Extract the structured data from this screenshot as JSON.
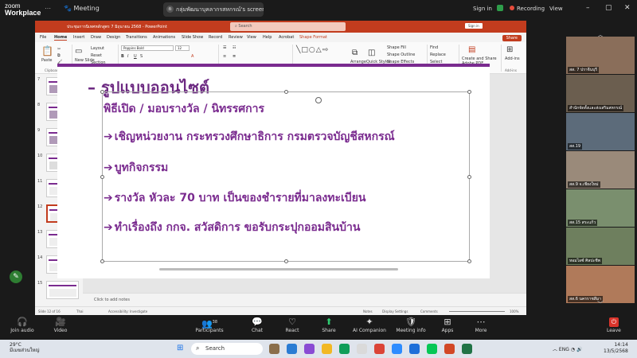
{
  "zoom": {
    "logo_line1": "zoom",
    "logo_line2": "Workplace",
    "meeting_label": "Meeting",
    "share_badge": "n",
    "share_label": "กลุ่มพัฒนาบุคลากรสหกรณ์'s screen",
    "sign_in": "Sign in",
    "recording": "Recording",
    "view": "View"
  },
  "ppt": {
    "window_title": "ประชุมการนิเทศหลักสูตร 7 มิถุนายน 2568 - PowerPoint",
    "search_placeholder": "Search",
    "sign_in": "Sign in",
    "share": "Share",
    "tabs": [
      "File",
      "Home",
      "Insert",
      "Draw",
      "Design",
      "Transitions",
      "Animations",
      "Slide Show",
      "Record",
      "Review",
      "View",
      "Help",
      "Acrobat",
      "Shape Format"
    ],
    "ribbon": {
      "paste": "Paste",
      "new_slide": "New Slide",
      "layout": "Layout",
      "reset": "Reset",
      "section": "Section",
      "font_name": "Poppins Bold",
      "font_size": "12",
      "arrange": "Arrange",
      "quick_styles": "Quick Styles",
      "shape_fill": "Shape Fill",
      "shape_outline": "Shape Outline",
      "shape_effects": "Shape Effects",
      "find": "Find",
      "replace": "Replace",
      "select": "Select",
      "create_pdf": "Create and Share Adobe PDF",
      "addins": "Add-ins",
      "groups": [
        "Clipboard",
        "Slides",
        "Font",
        "Paragraph",
        "Drawing",
        "Editing",
        "Adobe Acrobat",
        "Add-ins"
      ]
    },
    "thumb_numbers": [
      "7",
      "8",
      "9",
      "10",
      "11",
      "12",
      "13",
      "14",
      "15"
    ],
    "slide": {
      "title": "– รูปแบบออนไซต์",
      "subtitle": "พิธีเปิด / มอบรางวัล / นิทรรศการ",
      "bullets": [
        "เชิญหน่วยงาน กระทรวงศึกษาธิการ กรมตรวจบัญชีสหกรณ์",
        "บูทกิจกรรม",
        "รางวัล หัวละ 70 บาท เป็นของชำรายที่มาลงทะเบียน",
        "ทำเรื่องถึง กกจ. สวัสดิการ ขอรับกระปุกออมสินบ้าน"
      ]
    },
    "notes_placeholder": "Click to add notes",
    "status": {
      "slide_of": "Slide 12 of 16",
      "language": "Thai",
      "accessibility": "Accessibility: Investigate",
      "notes": "Notes",
      "display_settings": "Display Settings",
      "comments": "Comments",
      "zoom": "100%"
    }
  },
  "gallery": {
    "tiles": [
      {
        "name": "สส. 7 ปราจีนบุรี",
        "color": "#8a6e5a"
      },
      {
        "name": "สำนักจัดตั้งและส่งเสริมสหกรณ์",
        "color": "#6b5e4f"
      },
      {
        "name": "สส.19",
        "color": "#5c6b7a"
      },
      {
        "name": "สส.9 จ.เชียงใหม่",
        "color": "#9a8a7a"
      },
      {
        "name": "สส.15 สระแก้ว",
        "color": "#7a8f6e"
      },
      {
        "name": "หอมไอซ์ ศิลปะชีพ",
        "color": "#6e7f5e"
      },
      {
        "name": "สส.6 นครราชสีมา",
        "color": "#b07a5a"
      }
    ]
  },
  "toolbar": {
    "join_audio": "Join audio",
    "video": "Video",
    "participants": "Participants",
    "participants_count": "38",
    "chat": "Chat",
    "react": "React",
    "share": "Share",
    "ai_companion": "AI Companion",
    "meeting_info": "Meeting info",
    "apps": "Apps",
    "more": "More",
    "leave": "Leave"
  },
  "taskbar": {
    "temperature": "29°C",
    "weather_desc": "มีเมฆส่วนใหญ่",
    "search": "Search",
    "language": "ENG",
    "time": "14:14",
    "date": "13/5/2568"
  }
}
